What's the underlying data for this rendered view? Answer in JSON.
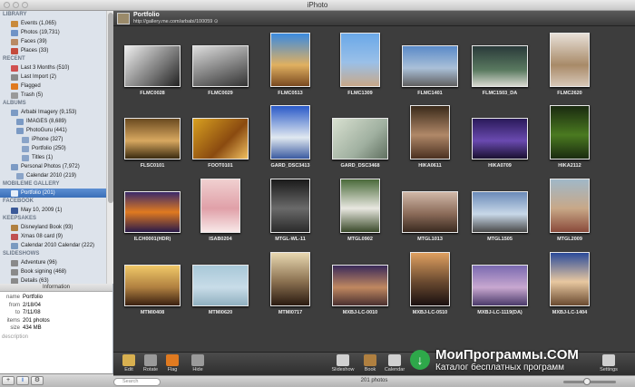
{
  "window": {
    "title": "iPhoto"
  },
  "sidebar": {
    "library": {
      "title": "LIBRARY",
      "items": [
        {
          "label": "Events (1,065)",
          "icon": "events-icon",
          "color": "#c98a3a"
        },
        {
          "label": "Photos (19,731)",
          "icon": "photos-icon",
          "color": "#6f93c6"
        },
        {
          "label": "Faces (39)",
          "icon": "faces-icon",
          "color": "#b98a64"
        },
        {
          "label": "Places (33)",
          "icon": "places-icon",
          "color": "#c44b3d"
        }
      ]
    },
    "recent": {
      "title": "RECENT",
      "items": [
        {
          "label": "Last 3 Months (510)",
          "icon": "calendar-icon",
          "color": "#d05050"
        },
        {
          "label": "Last Import (2)",
          "icon": "clock-icon",
          "color": "#8a8a8a"
        },
        {
          "label": "Flagged",
          "icon": "flag-icon",
          "color": "#e07a20"
        },
        {
          "label": "Trash (5)",
          "icon": "trash-icon",
          "color": "#9a9a9a"
        }
      ]
    },
    "albums": {
      "title": "ALBUMS",
      "items": [
        {
          "label": "Arbabi Imagery (9,153)",
          "icon": "folder-icon",
          "color": "#7b9ac4",
          "indent": 1
        },
        {
          "label": "IMAGES (8,689)",
          "icon": "folder-icon",
          "color": "#7b9ac4",
          "indent": 2
        },
        {
          "label": "PhotoGuru (441)",
          "icon": "folder-icon",
          "color": "#7b9ac4",
          "indent": 2
        },
        {
          "label": "iPhone (327)",
          "icon": "album-icon",
          "color": "#8aa4c8",
          "indent": 3
        },
        {
          "label": "Portfolio (250)",
          "icon": "album-icon",
          "color": "#8aa4c8",
          "indent": 3
        },
        {
          "label": "Titles (1)",
          "icon": "album-icon",
          "color": "#8aa4c8",
          "indent": 3
        },
        {
          "label": "Personal Photos (7,972)",
          "icon": "folder-icon",
          "color": "#7b9ac4",
          "indent": 1
        },
        {
          "label": "Calendar 2010 (219)",
          "icon": "album-icon",
          "color": "#8aa4c8",
          "indent": 2
        }
      ]
    },
    "mobileme": {
      "title": "MOBILEME GALLERY",
      "items": [
        {
          "label": "Portfolio (201)",
          "icon": "mobileme-icon",
          "color": "#e6eef8",
          "selected": true
        }
      ]
    },
    "facebook": {
      "title": "FACEBOOK",
      "items": [
        {
          "label": "May 10, 2009 (1)",
          "icon": "facebook-icon",
          "color": "#3b5998"
        }
      ]
    },
    "keepsakes": {
      "title": "KEEPSAKES",
      "items": [
        {
          "label": "Disneyland Book (93)",
          "icon": "book-icon",
          "color": "#b08040"
        },
        {
          "label": "Xmas 08 card (9)",
          "icon": "card-icon",
          "color": "#c05050"
        },
        {
          "label": "Calendar 2010 Calendar (222)",
          "icon": "calendar-icon",
          "color": "#7a9ac0"
        }
      ]
    },
    "slideshows": {
      "title": "SLIDESHOWS",
      "items": [
        {
          "label": "Adventure (96)",
          "icon": "slideshow-icon",
          "color": "#8a8a8a"
        },
        {
          "label": "Book signing (468)",
          "icon": "slideshow-icon",
          "color": "#8a8a8a"
        },
        {
          "label": "Details (63)",
          "icon": "slideshow-icon",
          "color": "#8a8a8a"
        }
      ]
    }
  },
  "info": {
    "title": "Information",
    "rows": [
      {
        "key": "name",
        "value": "Portfolio"
      },
      {
        "key": "from",
        "value": "2/18/04"
      },
      {
        "key": "to",
        "value": "7/11/08"
      },
      {
        "key": "items",
        "value": "201 photos"
      },
      {
        "key": "size",
        "value": "434 MB"
      }
    ],
    "description_placeholder": "description"
  },
  "sidebar_tools": [
    "+",
    "i",
    "⚙"
  ],
  "header": {
    "name": "Portfolio",
    "url": "http://gallery.me.com/arbabi/100059 ⊙"
  },
  "photos": [
    {
      "caption": "FLMC0028",
      "bg": "linear-gradient(135deg,#eee,#777 60%,#222)"
    },
    {
      "caption": "FLMC0029",
      "bg": "linear-gradient(160deg,#ddd,#888 50%,#333)"
    },
    {
      "caption": "FLMC0513",
      "bg": "linear-gradient(#3a8ae0,#e0b060 60%,#7a4a20)"
    },
    {
      "caption": "FLMC1309",
      "bg": "linear-gradient(#6aa8e8,#9ac0e8 55%,#c8a888)"
    },
    {
      "caption": "FLMC1401",
      "bg": "linear-gradient(#5a8ac8,#aac0d8 55%,#606060)"
    },
    {
      "caption": "FLMC1503_DA",
      "bg": "linear-gradient(#2a3a3a,#5a7a60 60%,#d8d8d0)"
    },
    {
      "caption": "FLMC2620",
      "bg": "linear-gradient(#e8e0d8,#a88a68 60%,#d8c8b8)"
    },
    {
      "caption": "FLSC0101",
      "bg": "linear-gradient(#6a4a20,#d8a860 55%,#3a2a10)"
    },
    {
      "caption": "FOOT0101",
      "bg": "linear-gradient(135deg,#d8a020,#8a4a10 60%,#f0c060)"
    },
    {
      "caption": "GARD_DSC3413",
      "bg": "linear-gradient(#2a5ac8,#e0e8f0 60%,#3a5aa0)"
    },
    {
      "caption": "GARD_DSC3468",
      "bg": "linear-gradient(135deg,#d8e0d0,#a0b0a0 60%,#607060)"
    },
    {
      "caption": "HIKA0611",
      "bg": "linear-gradient(#3a2a1a,#b08868 55%,#4a3020)"
    },
    {
      "caption": "HIKA0709",
      "bg": "linear-gradient(#2a1a5a,#6a4ab0 55%,#1a1030)"
    },
    {
      "caption": "HIKA2112",
      "bg": "linear-gradient(#1a2a10,#4a7a20 55%,#1a2a10)"
    },
    {
      "caption": "ILCH0001(HDR)",
      "bg": "linear-gradient(#3a2a6a,#e07a20 50%,#2a1a4a)"
    },
    {
      "caption": "ISAB0204",
      "bg": "linear-gradient(#f0d0d0,#e0a0a8 55%,#f8e8e8)"
    },
    {
      "caption": "MTGL-WL-11",
      "bg": "linear-gradient(#1a1a1a,#6a6a6a 55%,#2a2a2a)"
    },
    {
      "caption": "MTGL0902",
      "bg": "linear-gradient(#4a6a3a,#e8e8e0 55%,#3a4a2a)"
    },
    {
      "caption": "MTGL1013",
      "bg": "linear-gradient(#d0b8a8,#8a6a58 55%,#3a2a20)"
    },
    {
      "caption": "MTGL1505",
      "bg": "linear-gradient(#6a8ab8,#c8d8e8 55%,#4a4a4a)"
    },
    {
      "caption": "MTGL2009",
      "bg": "linear-gradient(#a0b8c8,#c8a888 55%,#8a4a3a)"
    },
    {
      "caption": "MTMI0408",
      "bg": "linear-gradient(#f0c868,#b08040 55%,#3a2010)"
    },
    {
      "caption": "MTMI0620",
      "bg": "linear-gradient(#a8c8d8,#c8dce8 55%,#90b0c0)"
    },
    {
      "caption": "MTMI0717",
      "bg": "linear-gradient(#e8d8b0,#8a7050 55%,#2a1a10)"
    },
    {
      "caption": "MXBJ-LC-0010",
      "bg": "linear-gradient(#3a2a5a,#c08860 55%,#4a3030)"
    },
    {
      "caption": "MXBJ-LC-0510",
      "bg": "linear-gradient(#e0a060,#6a4a30 55%,#1a1010)"
    },
    {
      "caption": "MXBJ-LC-1119(DA)",
      "bg": "linear-gradient(#7a6ab0,#c8a8d0 55%,#4a3a6a)"
    },
    {
      "caption": "MXBJ-LC-1404",
      "bg": "linear-gradient(#2a4a9a,#e8c8a0 55%,#6a4a30)"
    }
  ],
  "toolbar": {
    "left": [
      {
        "label": "Edit",
        "icon": "pencil-icon",
        "color": "#d8b050"
      },
      {
        "label": "Rotate",
        "icon": "rotate-icon",
        "color": "#9a9a9a"
      },
      {
        "label": "Flag",
        "icon": "flag-icon",
        "color": "#e07a20"
      },
      {
        "label": "Hide",
        "icon": "hide-icon",
        "color": "#9a9a9a"
      }
    ],
    "right": [
      {
        "label": "Slideshow",
        "icon": "play-icon",
        "color": "#d0d0d0"
      },
      {
        "label": "Book",
        "icon": "book-icon",
        "color": "#b08040"
      },
      {
        "label": "Calendar",
        "icon": "calendar-icon",
        "color": "#d0d0d0"
      },
      {
        "label": "Settings",
        "icon": "gear-icon",
        "color": "#d0d0d0"
      }
    ]
  },
  "bottombar": {
    "search_placeholder": "Search",
    "count": "201 photos"
  },
  "watermark": {
    "main": "МоиПрограммы.COM",
    "sub": "Каталог бесплатных программ",
    "badge": "↓"
  }
}
